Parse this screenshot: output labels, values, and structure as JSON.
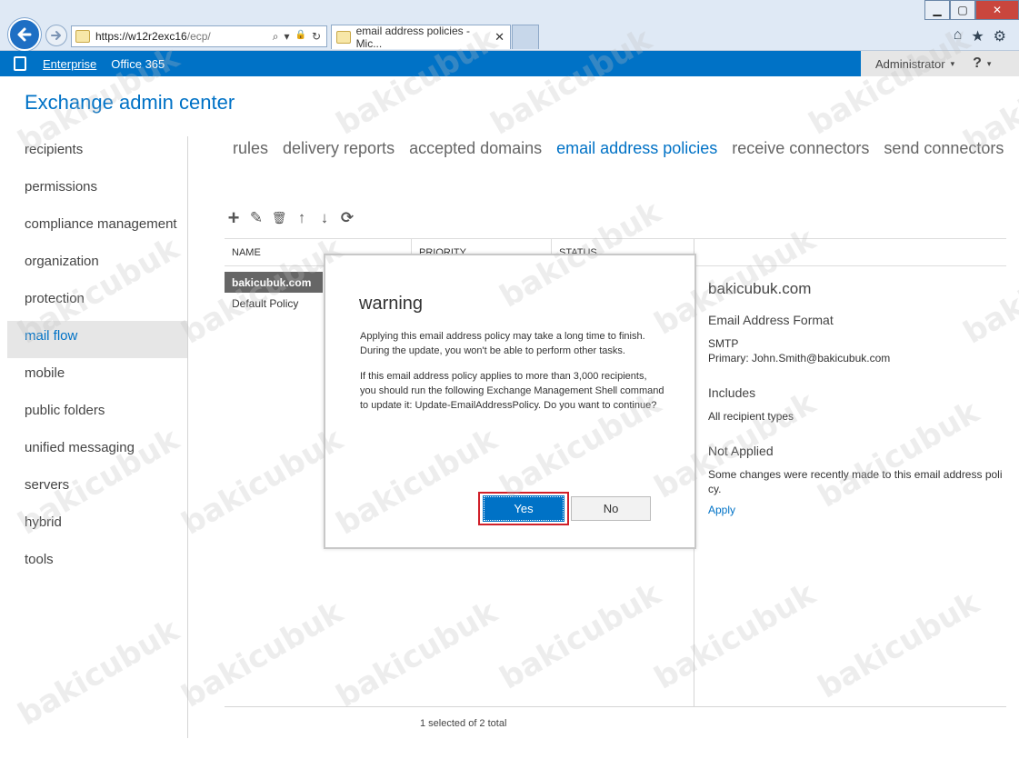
{
  "browser": {
    "address": {
      "url_main": "https://w12r2exc16",
      "url_path": "/ecp/",
      "search_glyph": "⌕",
      "dropdown_glyph": "▾",
      "lock_glyph": "🔒",
      "refresh_glyph": "↻"
    },
    "tab": {
      "title": "email address policies - Mic...",
      "close_glyph": "✕"
    },
    "window_controls": {
      "minimize": "▁",
      "maximize": "▢",
      "close": "✕"
    },
    "tool_icons": {
      "home": "⌂",
      "favorites": "★",
      "settings": "⚙"
    }
  },
  "appbar": {
    "links": [
      "Enterprise",
      "Office 365"
    ],
    "user": "Administrator",
    "user_caret": "▾",
    "help": "?",
    "help_caret": "▾",
    "brand_color": "#0072c6"
  },
  "title": "Exchange admin center",
  "leftnav": {
    "items": [
      "recipients",
      "permissions",
      "compliance management",
      "organization",
      "protection",
      "mail flow",
      "mobile",
      "public folders",
      "unified messaging",
      "servers",
      "hybrid",
      "tools"
    ],
    "active": "mail flow"
  },
  "subtabs": {
    "items": [
      "rules",
      "delivery reports",
      "accepted domains",
      "email address policies",
      "receive connectors",
      "send connectors"
    ],
    "active": "email address policies"
  },
  "toolbar": {
    "add": "+",
    "edit": "✎",
    "delete": "🗑",
    "up": "↑",
    "down": "↓",
    "refresh": "⟳"
  },
  "list": {
    "columns": [
      "NAME",
      "PRIORITY",
      "STATUS"
    ],
    "rows": [
      "bakicubuk.com",
      "Default Policy"
    ],
    "footer": "1 selected of 2 total"
  },
  "details": {
    "title": "bakicubuk.com",
    "format_heading": "Email Address Format",
    "format_type": "SMTP",
    "format_primary": "Primary: John.Smith@bakicubuk.com",
    "includes_heading": "Includes",
    "includes_value": "All recipient types",
    "not_applied_heading": "Not Applied",
    "not_applied_text": "Some changes were recently made to this email address poli cy.",
    "apply_link": "Apply"
  },
  "modal": {
    "title": "warning",
    "paragraph1": "Applying this email address policy may take a long time to finish. During the update, you won't be able to perform other tasks.",
    "paragraph2": "If this email address policy applies to more than 3,000 recipients, you should run the following Exchange Management Shell command to update it: Update-EmailAddressPolicy. Do you want to continue?",
    "yes": "Yes",
    "no": "No",
    "highlight_color": "#d0202a"
  },
  "watermark": "bakicubuk"
}
